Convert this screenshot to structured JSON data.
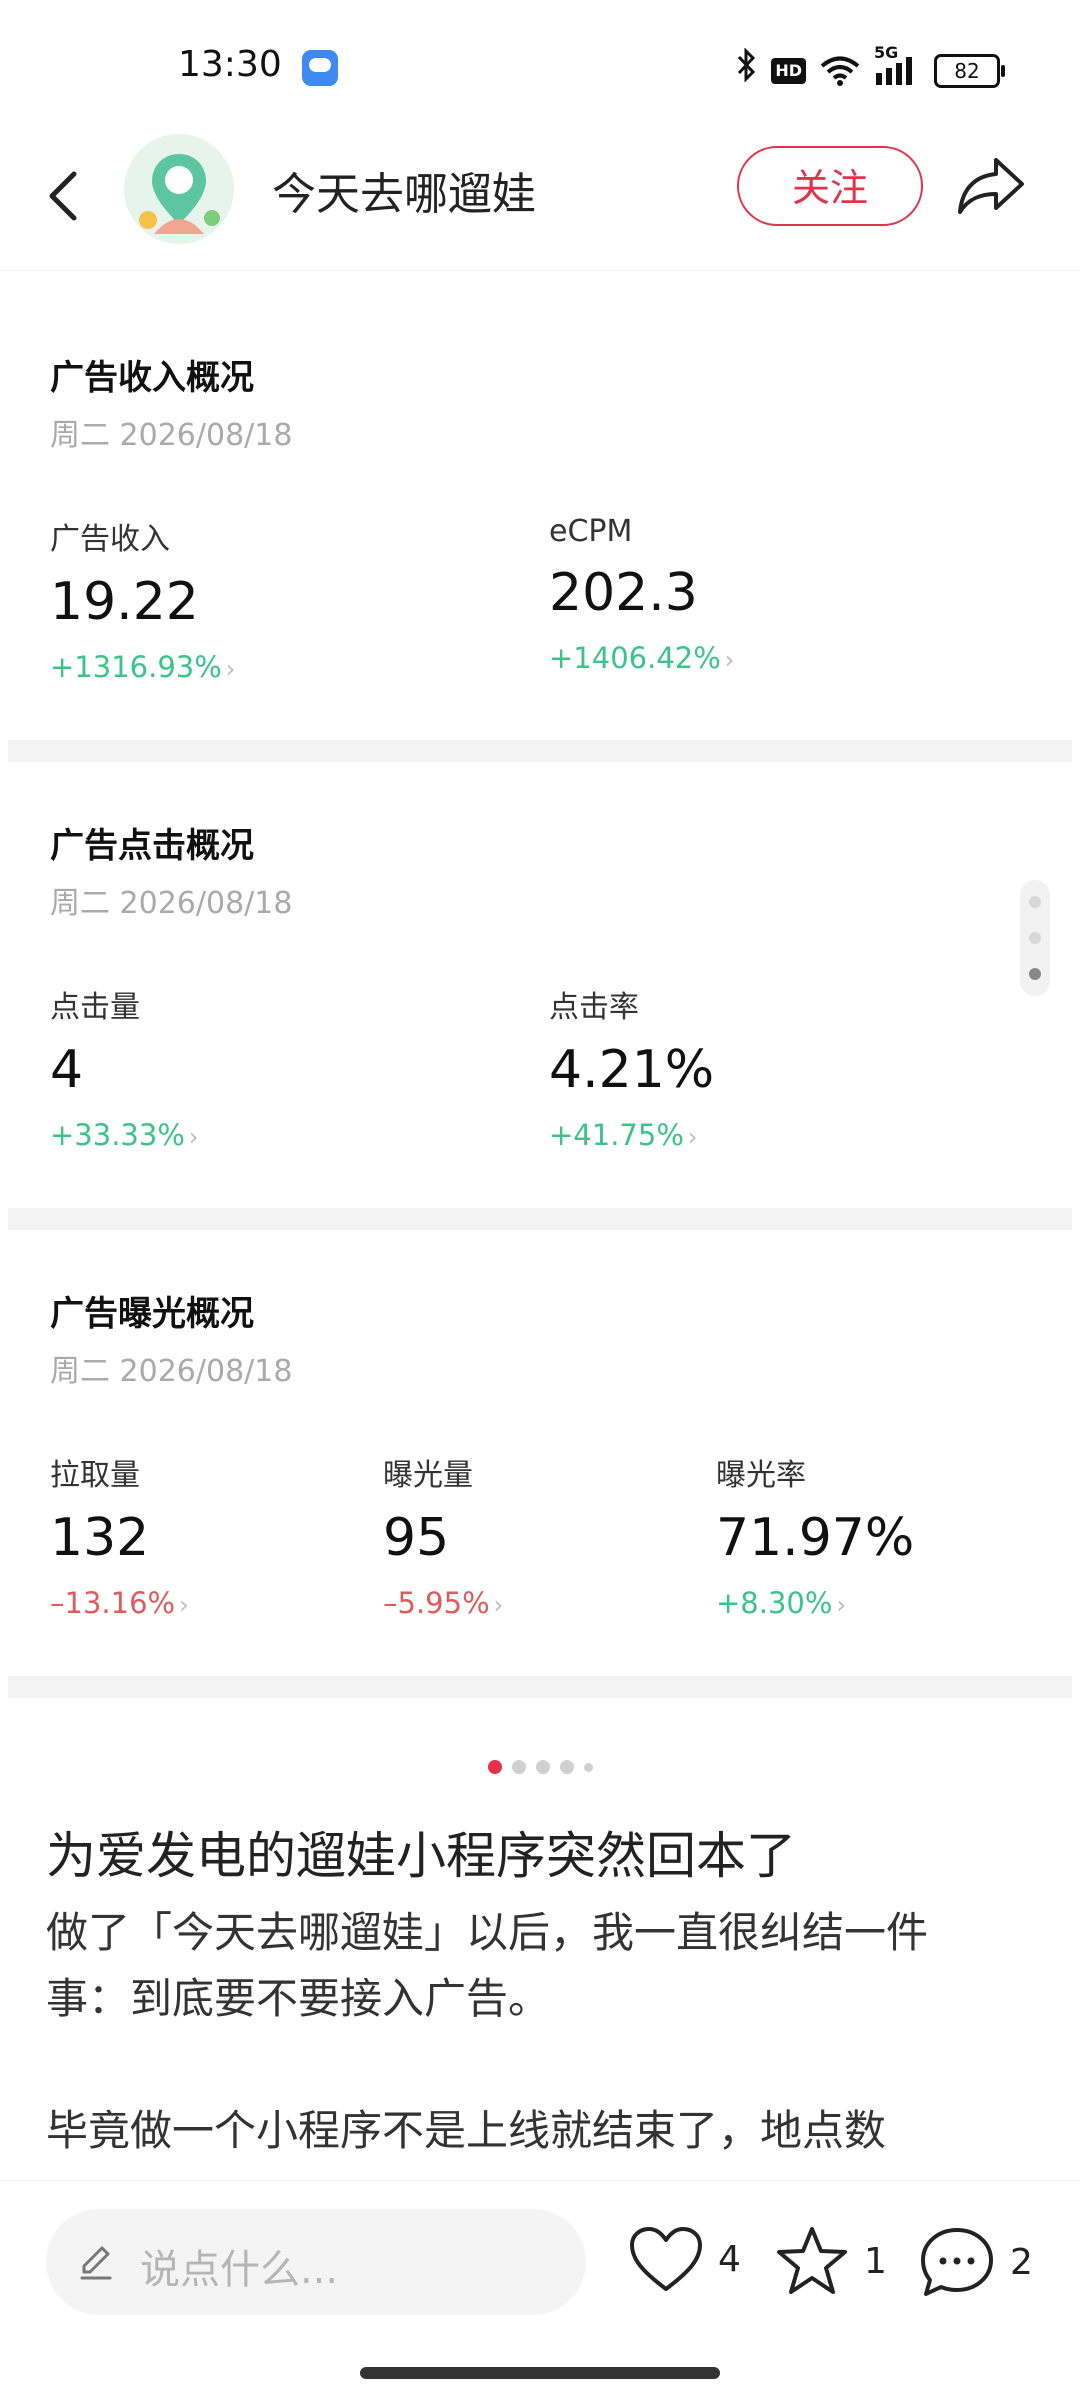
{
  "status_bar": {
    "time": "13:30",
    "icons": [
      "weather-icon",
      "bluetooth-icon",
      "hd-icon",
      "wifi-icon",
      "signal-5g-icon",
      "battery-icon"
    ],
    "network": "5G",
    "hd": "HD",
    "battery": "82"
  },
  "header": {
    "title": "今天去哪遛娃",
    "follow_label": "关注"
  },
  "cards": {
    "revenue": {
      "title": "广告收入概况",
      "date": "周二 2026/08/18",
      "metrics": [
        {
          "label": "广告收入",
          "value": "19.22",
          "change": "+1316.93%"
        },
        {
          "label": "eCPM",
          "value": "202.3",
          "change": "+1406.42%"
        }
      ]
    },
    "clicks": {
      "title": "广告点击概况",
      "date": "周二 2026/08/18",
      "metrics": [
        {
          "label": "点击量",
          "value": "4",
          "change": "+33.33%"
        },
        {
          "label": "点击率",
          "value": "4.21%",
          "change": "+41.75%"
        }
      ]
    },
    "exposure": {
      "title": "广告曝光概况",
      "date": "周二 2026/08/18",
      "metrics": [
        {
          "label": "拉取量",
          "value": "132",
          "change": "–13.16%"
        },
        {
          "label": "曝光量",
          "value": "95",
          "change": "–5.95%"
        },
        {
          "label": "曝光率",
          "value": "71.97%",
          "change": "+8.30%"
        }
      ]
    }
  },
  "colors": {
    "accent": "#e0344c",
    "positive": "#3cc38a",
    "negative": "#e05b5b"
  },
  "pager": {
    "count": 5,
    "active_index": 0
  },
  "article": {
    "title": "为爱发电的遛娃小程序突然回本了",
    "para1_line1": "做了「今天去哪遛娃」以后，我一直很纠结一件",
    "para1_line2": "事：到底要不要接入广告。",
    "para2_line1": "毕竟做一个小程序不是上线就结束了，地点数"
  },
  "bottom_bar": {
    "comment_placeholder": "说点什么...",
    "like_count": "4",
    "star_count": "1",
    "comment_count": "2"
  }
}
